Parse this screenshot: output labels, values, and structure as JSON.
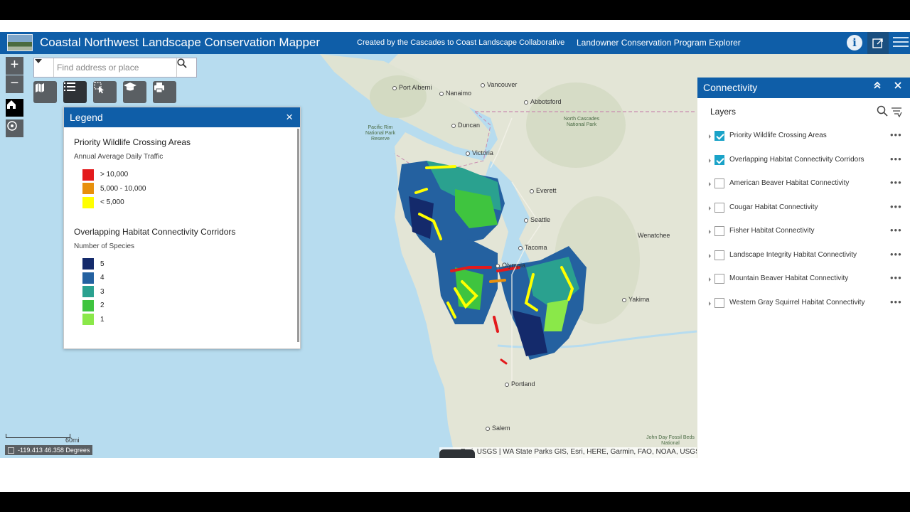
{
  "header": {
    "title": "Coastal Northwest Landscape Conservation Mapper",
    "created_by": "Created by the Cascades to Coast Landscape Collaborative",
    "explorer": "Landowner Conservation Program Explorer",
    "info_glyph": "i"
  },
  "search": {
    "placeholder": "Find address or place"
  },
  "zoom": {
    "in": "+",
    "out": "−"
  },
  "legend": {
    "title": "Legend",
    "close": "×",
    "sections": [
      {
        "title": "Priority Wildlife Crossing Areas",
        "subtitle": "Annual Average Daily Traffic",
        "items": [
          {
            "label": "> 10,000",
            "color": "#e31a1c"
          },
          {
            "label": "5,000 - 10,000",
            "color": "#e8900c"
          },
          {
            "label": "< 5,000",
            "color": "#ffff00"
          }
        ]
      },
      {
        "title": "Overlapping Habitat Connectivity Corridors",
        "subtitle": "Number of Species",
        "items": [
          {
            "label": "5",
            "color": "#142a6b"
          },
          {
            "label": "4",
            "color": "#2461a0"
          },
          {
            "label": "3",
            "color": "#2aa18f"
          },
          {
            "label": "2",
            "color": "#3fc43f"
          },
          {
            "label": "1",
            "color": "#8ae849"
          }
        ]
      }
    ]
  },
  "panel": {
    "title": "Connectivity",
    "layers_title": "Layers",
    "layers": [
      {
        "name": "Priority Wildlife Crossing Areas",
        "checked": true
      },
      {
        "name": "Overlapping Habitat Connectivity Corridors",
        "checked": true
      },
      {
        "name": "American Beaver Habitat Connectivity",
        "checked": false
      },
      {
        "name": "Cougar Habitat Connectivity",
        "checked": false
      },
      {
        "name": "Fisher Habitat Connectivity",
        "checked": false
      },
      {
        "name": "Landscape Integrity Habitat Connectivity",
        "checked": false
      },
      {
        "name": "Mountain Beaver Habitat Connectivity",
        "checked": false
      },
      {
        "name": "Western Gray Squirrel Habitat Connectivity",
        "checked": false
      }
    ],
    "more_glyph": "•••"
  },
  "map": {
    "cities": [
      "Port Alberni",
      "Nanaimo",
      "Vancouver",
      "Abbotsford",
      "Duncan",
      "Victoria",
      "Everett",
      "Seattle",
      "Tacoma",
      "Olympia",
      "Wenatchee",
      "Yakima",
      "Portland",
      "Salem"
    ],
    "parks": [
      "Pacific Rim National Park Reserve",
      "North Cascades National Park",
      "John Day Fossil Beds National"
    ],
    "scale_label": "60mi",
    "coordinates": "-119.413 46.358 Degrees",
    "attribution": "Esri, USGS | WA State Parks GIS, Esri, HERE, Garmin, FAO, NOAA, USGS"
  },
  "colors": {
    "header": "#0f5ea8",
    "water": "#b7dcef",
    "land": "#e3e5d6"
  },
  "toolbar_icons": [
    "bookmark-icon",
    "layer-list-icon",
    "select-icon",
    "education-icon",
    "print-icon"
  ]
}
